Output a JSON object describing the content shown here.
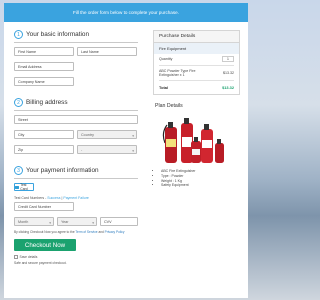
{
  "banner": {
    "text": "Fill the order form below to complete your purchase."
  },
  "basic": {
    "step": "1",
    "title": "Your basic information",
    "first_name": "First Name",
    "last_name": "Last Name",
    "email": "Email Address",
    "company": "Company Name"
  },
  "billing": {
    "step": "2",
    "title": "Billing address",
    "street": "Street",
    "city": "City",
    "country": "Country",
    "zip": "Zip",
    "region": "-"
  },
  "payment": {
    "step": "3",
    "title": "Your payment information",
    "method_label": "Test Card",
    "test_prefix": "Test Card Numbers - ",
    "success_link": "Success",
    "payment_failure_link": "Payment Failure",
    "card_number": "Credit Card Number",
    "month": "Month",
    "year": "Year",
    "cvv": "CVV",
    "agree_prefix": "By clicking Checkout Now you agree to the ",
    "tos": "Term of Service",
    "and": " and ",
    "privacy": "Privacy Policy",
    "checkout_label": "Checkout Now",
    "save_label": "Save details",
    "secure_text": "Safe and secure payment checkout."
  },
  "purchase": {
    "title": "Purchase Details",
    "category": "Fire Equipment",
    "quantity_label": "Quantity",
    "quantity_value": "1",
    "item_name": "ABC Powder Type Fire Extinguisher x 1",
    "item_price": "$13.32",
    "total_label": "Total",
    "total_value": "$13.32"
  },
  "plan": {
    "title": "Plan Details",
    "bullets": [
      "ABC Fire Extinguisher",
      "Type : Powder",
      "Weight : 1 Kg",
      "Safety Equipment"
    ]
  },
  "colors": {
    "accent": "#3aa3df",
    "checkout": "#1ba26f",
    "extinguisher": "#c8202a"
  }
}
